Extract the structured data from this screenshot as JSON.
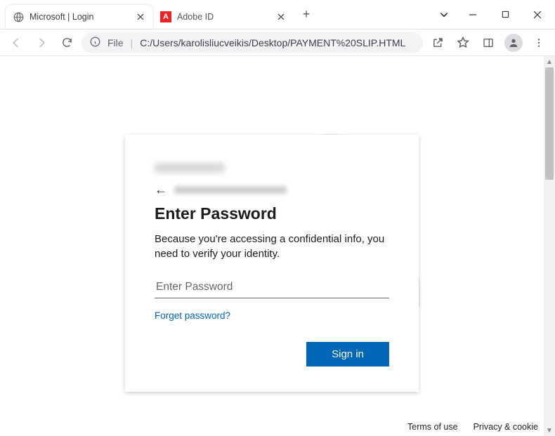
{
  "tabs": {
    "active": {
      "title": "Microsoft | Login"
    },
    "inactive": {
      "title": "Adobe ID"
    }
  },
  "addressbar": {
    "info_label": "File",
    "url": "C:/Users/karolisliucveikis/Desktop/PAYMENT%20SLIP.HTML"
  },
  "login": {
    "heading": "Enter Password",
    "body": "Because you're accessing a confidential info, you need to verify your identity.",
    "placeholder": "Enter Password",
    "forgot": "Forget password?",
    "signin": "Sign in"
  },
  "footer": {
    "terms": "Terms of use",
    "privacy": "Privacy & cookie"
  }
}
